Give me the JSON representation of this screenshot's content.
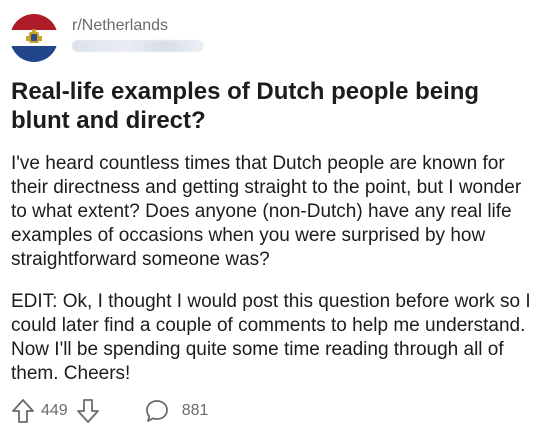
{
  "post": {
    "subreddit": "r/Netherlands",
    "title": "Real-life examples of Dutch people being blunt and direct?",
    "body": [
      "I've heard countless times that Dutch people are known for their directness and getting straight to the point, but I wonder to what extent? Does anyone (non-Dutch) have any real life examples of occasions when you were surprised by how straightforward someone was?",
      "EDIT: Ok, I thought I would post this question before work so I could later find a couple of comments to help me understand. Now I'll be spending quite some time reading through all of them. Cheers!"
    ],
    "votes": "449",
    "comments": "881"
  },
  "icons": {
    "avatar": "netherlands-flag-avatar",
    "upvote": "upvote-arrow-icon",
    "downvote": "downvote-arrow-icon",
    "comment": "comment-bubble-icon"
  },
  "colors": {
    "flag_red": "#ae1c28",
    "flag_white": "#ffffff",
    "flag_blue": "#21468b",
    "muted_text": "#6b6b6b",
    "text": "#1c1c1c"
  }
}
